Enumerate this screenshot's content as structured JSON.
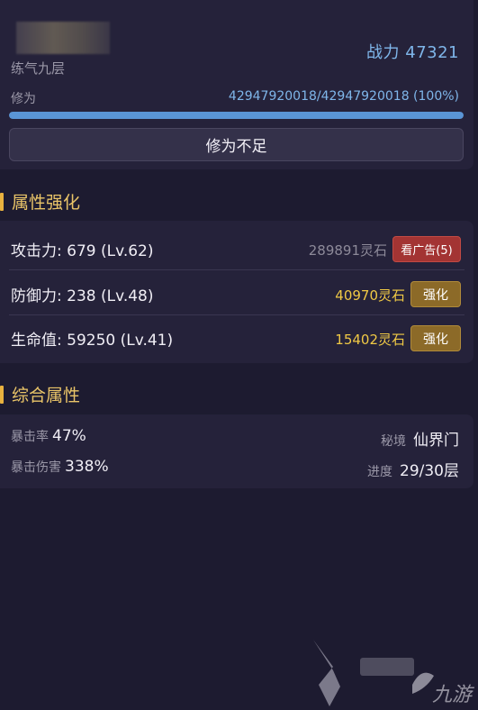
{
  "header": {
    "realm": "练气九层",
    "power_label": "战力 47321",
    "xiuwei_label": "修为",
    "xiuwei_value": "42947920018/42947920018 (100%)",
    "xiuwei_progress": 1.0,
    "action_button": "修为不足"
  },
  "attributes": {
    "title": "属性强化",
    "rows": [
      {
        "name": "攻击力: 679 (Lv.62)",
        "cost": "289891灵石",
        "button": "看广告(5)",
        "type": "ad"
      },
      {
        "name": "防御力: 238 (Lv.48)",
        "cost": "40970灵石",
        "button": "强化",
        "type": "upgrade"
      },
      {
        "name": "生命值: 59250 (Lv.41)",
        "cost": "15402灵石",
        "button": "强化",
        "type": "upgrade"
      }
    ]
  },
  "overall": {
    "title": "综合属性",
    "crit_rate_label": "暴击率",
    "crit_rate_value": "47%",
    "crit_dmg_label": "暴击伤害",
    "crit_dmg_value": "338%",
    "realm_label": "秘境",
    "realm_value": "仙界门",
    "progress_label": "进度",
    "progress_value": "29/30层"
  },
  "colors": {
    "accent_gold": "#e9c468",
    "accent_blue": "#7fb6ea",
    "ad_red": "#a33433",
    "upgrade_gold": "#8c6a28"
  },
  "watermark": {
    "logo_text": "九游"
  }
}
